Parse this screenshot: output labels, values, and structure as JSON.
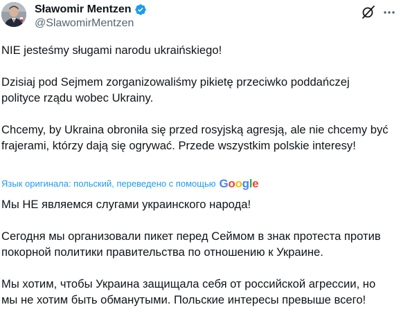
{
  "author": {
    "display_name": "Sławomir Mentzen",
    "handle": "@SlawomirMentzen"
  },
  "colors": {
    "text": "#0f1419",
    "secondary": "#536471",
    "accent": "#1d9bf0"
  },
  "icons": {
    "verified": "verified-badge-icon",
    "grok": "grok-icon",
    "more": "more-icon"
  },
  "tweet": {
    "paragraphs": [
      "NIE jesteśmy sługami narodu ukraińskiego!",
      "Dzisiaj pod Sejmem zorganizowaliśmy pikietę przeciwko poddańczej polityce rządu wobec Ukrainy.",
      "Chcemy, by Ukraina obroniła się przed rosyjską agresją, ale nie chcemy być frajerami, którzy dają się ogrywać. Przede wszystkim polskie interesy!"
    ]
  },
  "translation": {
    "note": "Язык оригинала: польский, переведено с помощью",
    "provider": "Google",
    "paragraphs": [
      "Мы НЕ являемся слугами украинского народа!",
      "Сегодня мы организовали пикет перед Сеймом в знак протеста против покорной политики правительства по отношению к Украине.",
      "Мы хотим, чтобы Украина защищала себя от российской агрессии, но мы не хотим быть обманутыми. Польские интересы превыше всего!"
    ]
  }
}
